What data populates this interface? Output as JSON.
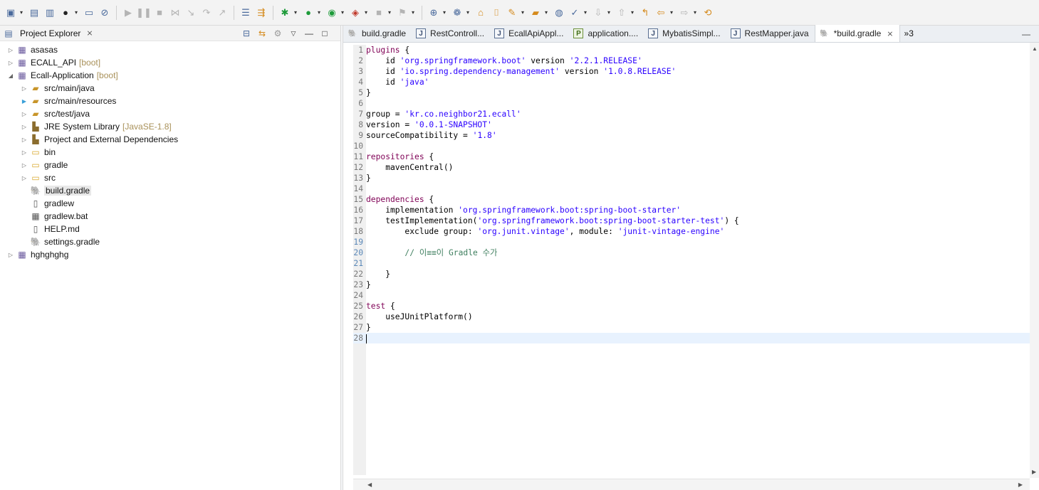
{
  "toolbar": {
    "icons": [
      "new-icon",
      "save-icon",
      "save-all-icon",
      "profile-icon",
      "terminal-icon",
      "skip-breakpoints-icon",
      "resume-icon",
      "suspend-icon",
      "terminate-icon",
      "disconnect-icon",
      "step-into-icon",
      "step-over-icon",
      "step-return-icon",
      "drop-to-frame-icon",
      "use-step-filters-icon",
      "debug-icon",
      "run-icon",
      "coverage-icon",
      "external-tools-icon",
      "stop-icon",
      "build-icon",
      "new-class-icon",
      "spring-icon",
      "open-type-icon",
      "open-task-icon",
      "search-icon",
      "open-folder-icon",
      "globe-icon",
      "annotation-icon",
      "next-annotation-icon",
      "prev-annotation-icon",
      "back-icon",
      "forward-icon",
      "sync-icon"
    ]
  },
  "explorer": {
    "title": "Project Explorer",
    "close": "⨯",
    "items": [
      {
        "label": "asasas",
        "decor": ""
      },
      {
        "label": "ECALL_API",
        "decor": "[boot]"
      },
      {
        "label": "Ecall-Application",
        "decor": "[boot]"
      },
      {
        "label": "src/main/java",
        "decor": ""
      },
      {
        "label": "src/main/resources",
        "decor": ""
      },
      {
        "label": "src/test/java",
        "decor": ""
      },
      {
        "label": "JRE System Library",
        "decor": "[JavaSE-1.8]"
      },
      {
        "label": "Project and External Dependencies",
        "decor": ""
      },
      {
        "label": "bin",
        "decor": ""
      },
      {
        "label": "gradle",
        "decor": ""
      },
      {
        "label": "src",
        "decor": ""
      },
      {
        "label": "build.gradle",
        "decor": ""
      },
      {
        "label": "gradlew",
        "decor": ""
      },
      {
        "label": "gradlew.bat",
        "decor": ""
      },
      {
        "label": "HELP.md",
        "decor": ""
      },
      {
        "label": "settings.gradle",
        "decor": ""
      },
      {
        "label": "hghghghg",
        "decor": ""
      }
    ]
  },
  "editor": {
    "tabs": [
      {
        "label": "build.gradle",
        "icon": "gradle"
      },
      {
        "label": "RestControll...",
        "icon": "J"
      },
      {
        "label": "EcallApiAppl...",
        "icon": "J"
      },
      {
        "label": "application....",
        "icon": "P"
      },
      {
        "label": "MybatisSimpl...",
        "icon": "J"
      },
      {
        "label": "RestMapper.java",
        "icon": "J"
      },
      {
        "label": "*build.gradle",
        "icon": "gradle"
      }
    ],
    "tab_close": "⨯",
    "overflow": "»3",
    "minimize": "—",
    "line_numbers": [
      "1",
      "2",
      "3",
      "4",
      "5",
      "6",
      "7",
      "8",
      "9",
      "10",
      "11",
      "12",
      "13",
      "14",
      "15",
      "16",
      "17",
      "18",
      "19",
      "20",
      "21",
      "22",
      "23",
      "24",
      "25",
      "26",
      "27",
      "28"
    ],
    "code": {
      "l1_kw": "plugins",
      "l1_rest": " {",
      "l2_a": "    id ",
      "l2_s1": "'org.springframework.boot'",
      "l2_b": " version ",
      "l2_s2": "'2.2.1.RELEASE'",
      "l3_a": "    id ",
      "l3_s1": "'io.spring.dependency-management'",
      "l3_b": " version ",
      "l3_s2": "'1.0.8.RELEASE'",
      "l4_a": "    id ",
      "l4_s1": "'java'",
      "l5": "}",
      "l7_a": "group = ",
      "l7_s": "'kr.co.neighbor21.ecall'",
      "l8_a": "version = ",
      "l8_s": "'0.0.1-SNAPSHOT'",
      "l9_a": "sourceCompatibility = ",
      "l9_s": "'1.8'",
      "l11_kw": "repositories",
      "l11_rest": " {",
      "l12": "    mavenCentral()",
      "l13": "}",
      "l15_kw": "dependencies",
      "l15_rest": " {",
      "l16_a": "    implementation ",
      "l16_s": "'org.springframework.boot:spring-boot-starter'",
      "l17_a": "    testImplementation(",
      "l17_s": "'org.springframework.boot:spring-boot-starter-test'",
      "l17_b": ") {",
      "l18_a": "        exclude group: ",
      "l18_s1": "'org.junit.vintage'",
      "l18_b": ", module: ",
      "l18_s2": "'junit-vintage-engine'",
      "l20": "        // 이≡≡이 Gradle 수가",
      "l22": "    }",
      "l23": "}",
      "l25_kw": "test",
      "l25_rest": " {",
      "l26": "    useJUnitPlatform()",
      "l27": "}"
    }
  }
}
